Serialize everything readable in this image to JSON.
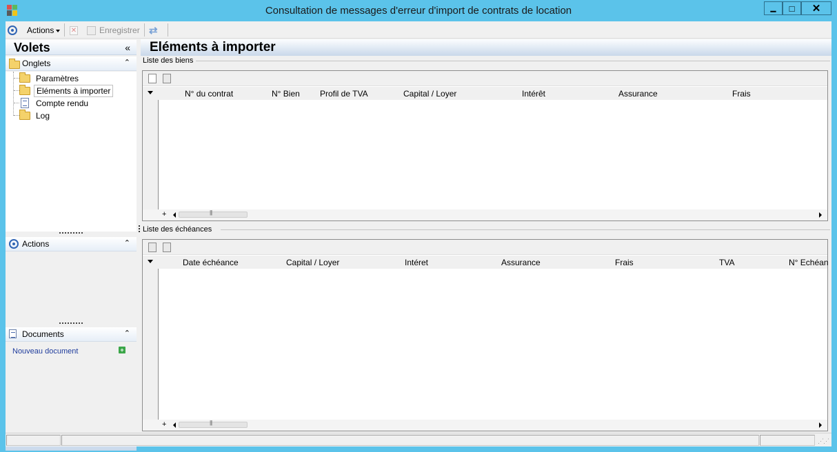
{
  "window": {
    "title": "Consultation de messages d'erreur d'import de contrats de location",
    "buttons": {
      "minimize": "▁",
      "maximize": "□",
      "close": "✕"
    }
  },
  "toolbar": {
    "actions_label": "Actions",
    "save_label": "Enregistrer"
  },
  "left_panel": {
    "title": "Volets",
    "collapse_glyph": "«",
    "onglets": {
      "label": "Onglets",
      "items": [
        {
          "label": "Paramètres",
          "icon": "folder-icon"
        },
        {
          "label": "Eléments à importer",
          "icon": "folder-open-icon",
          "selected": true
        },
        {
          "label": "Compte rendu",
          "icon": "document-icon"
        },
        {
          "label": "Log",
          "icon": "folder-icon"
        }
      ]
    },
    "actions": {
      "label": "Actions"
    },
    "documents": {
      "label": "Documents",
      "new_document": "Nouveau document"
    }
  },
  "main": {
    "title": "Eléments à importer",
    "biens": {
      "group_label": "Liste des biens",
      "columns": [
        "N° du contrat",
        "N° Bien",
        "Profil de TVA",
        "Capital / Loyer",
        "Intérêt",
        "Assurance",
        "Frais"
      ]
    },
    "echeances": {
      "group_label": "Liste des échéances",
      "columns": [
        "Date échéance",
        "Capital / Loyer",
        "Intéret",
        "Assurance",
        "Frais",
        "TVA",
        "N° Echéan"
      ]
    }
  },
  "colors": {
    "window_frame": "#5bc3ea",
    "panel_bg": "#f0f0f0",
    "link": "#1f3c9c",
    "accent_blue": "#2f64b4"
  }
}
